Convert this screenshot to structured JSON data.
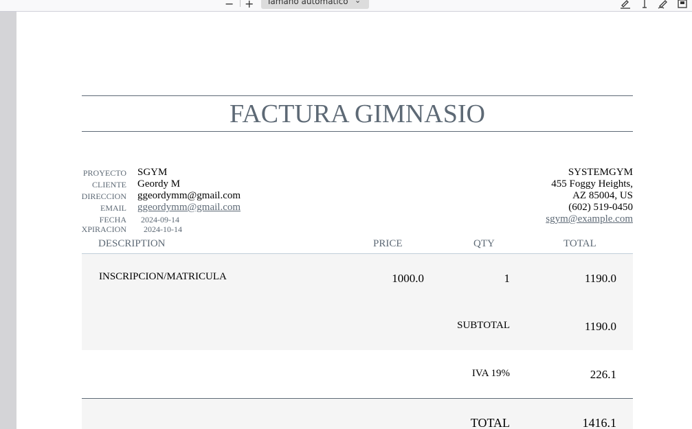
{
  "viewer": {
    "zoom_label": "Tamaño automático",
    "zoom_out_symbol": "−",
    "zoom_in_symbol": "+",
    "chevron_symbol": "⌄"
  },
  "invoice": {
    "title": "FACTURA GIMNASIO",
    "meta": [
      {
        "label": "PROYECTO",
        "value": "SGYM"
      },
      {
        "label": "CLIENTE",
        "value": "Geordy M"
      },
      {
        "label": "DIRECCION",
        "value": "ggeordymm@gmail.com"
      },
      {
        "label": "EMAIL",
        "value": "ggeordymm@gmail.com"
      },
      {
        "label": "FECHA",
        "value": "2024-09-14"
      },
      {
        "label": "XPIRACION",
        "value": "2024-10-14"
      }
    ],
    "company": {
      "name": "SYSTEMGYM",
      "address1": "455 Foggy Heights,",
      "address2": "AZ 85004, US",
      "phone": "(602) 519-0450",
      "email": "sgym@example.com"
    },
    "columns": {
      "description": "DESCRIPTION",
      "price": "PRICE",
      "qty": "QTY",
      "total": "TOTAL"
    },
    "items": [
      {
        "description": "INSCRIPCION/MATRICULA",
        "price": "1000.0",
        "qty": "1",
        "total": "1190.0"
      }
    ],
    "subtotal": {
      "label": "SUBTOTAL",
      "value": "1190.0"
    },
    "tax": {
      "label": "IVA 19%",
      "value": "226.1"
    },
    "grand_total": {
      "label": "TOTAL",
      "value": "1416.1"
    }
  }
}
